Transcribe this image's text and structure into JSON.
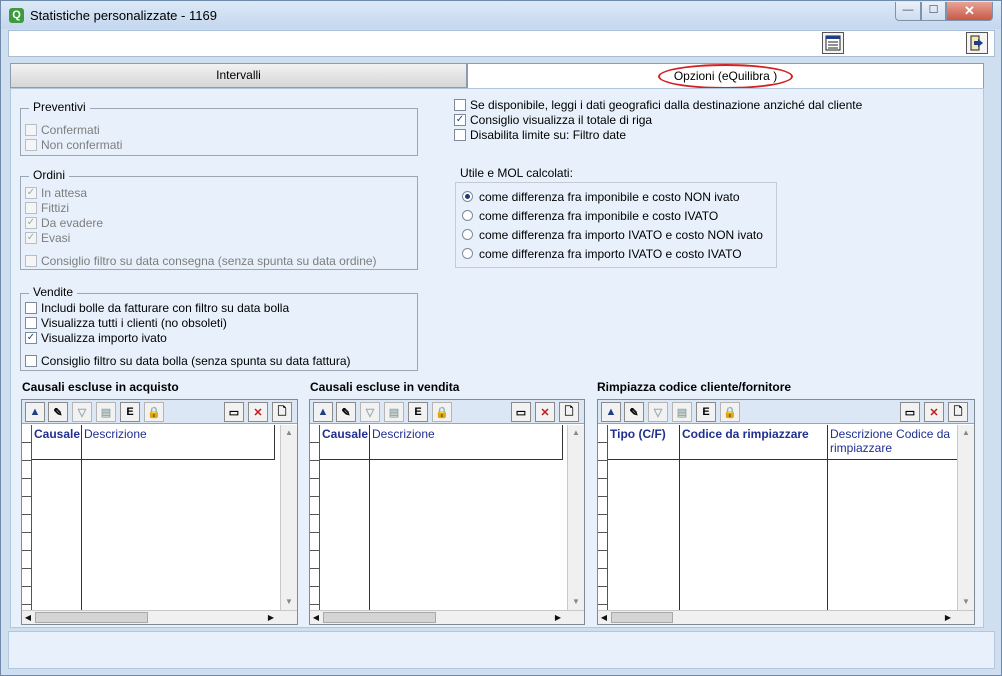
{
  "window": {
    "title": "Statistiche personalizzate - 1169",
    "min": "—",
    "max": "☐",
    "close": "✕"
  },
  "tabs": [
    {
      "label": "Intervalli"
    },
    {
      "label": "Opzioni (eQuilibra )"
    }
  ],
  "preventivi": {
    "title": "Preventivi",
    "items": [
      {
        "label": "Confermati",
        "checked": false
      },
      {
        "label": "Non confermati",
        "checked": false
      }
    ]
  },
  "ordini": {
    "title": "Ordini",
    "items": [
      {
        "label": "In attesa",
        "checked": true
      },
      {
        "label": "Fittizi",
        "checked": false
      },
      {
        "label": "Da evadere",
        "checked": true
      },
      {
        "label": "Evasi",
        "checked": true
      }
    ],
    "consiglio": {
      "label": "Consiglio filtro su data consegna (senza spunta su data ordine)",
      "checked": false
    }
  },
  "vendite": {
    "title": "Vendite",
    "items": [
      {
        "label": "Includi bolle da fatturare con filtro su data bolla",
        "checked": false
      },
      {
        "label": "Visualizza tutti i clienti (no obsoleti)",
        "checked": false
      },
      {
        "label": "Visualizza importo ivato",
        "checked": true
      }
    ],
    "consiglio": {
      "label": "Consiglio filtro su data bolla (senza spunta su data fattura)",
      "checked": false
    }
  },
  "options": [
    {
      "label": "Se disponibile, leggi i dati geografici dalla destinazione anziché dal cliente",
      "checked": false
    },
    {
      "label": "Consiglio visualizza il totale di riga",
      "checked": true
    },
    {
      "label": "Disabilita limite su: Filtro date",
      "checked": false
    }
  ],
  "utile": {
    "title": "Utile e MOL calcolati:",
    "options": [
      {
        "label": "come differenza fra imponibile e costo NON ivato",
        "selected": true
      },
      {
        "label": "come differenza fra imponibile e costo IVATO",
        "selected": false
      },
      {
        "label": "come differenza fra importo IVATO e costo NON ivato",
        "selected": false
      },
      {
        "label": "come differenza fra importo IVATO e costo IVATO",
        "selected": false
      }
    ]
  },
  "grids": [
    {
      "title": "Causali escluse in acquisto",
      "columns": [
        "Causale",
        "Descrizione"
      ]
    },
    {
      "title": "Causali escluse in vendita",
      "columns": [
        "Causale",
        "Descrizione"
      ]
    },
    {
      "title": "Rimpiazza codice cliente/fornitore",
      "columns": [
        "Tipo (C/F)",
        "Codice da rimpiazzare",
        "Descrizione Codice da rimpiazzare"
      ]
    }
  ],
  "icons": {
    "check": "✓",
    "up": "▲",
    "filter": "▽",
    "copy": "▤",
    "excel": "E",
    "lock": "🔒",
    "window": "▭",
    "delete": "✕",
    "new": "🗋",
    "edit": "✎",
    "scroll_up": "▲",
    "scroll_down": "▼",
    "scroll_left": "◀",
    "scroll_right": "▶"
  }
}
